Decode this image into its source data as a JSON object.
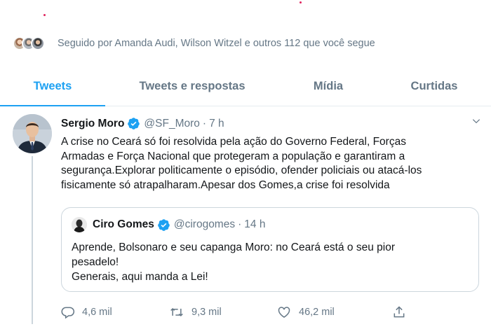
{
  "followed_by": {
    "text": "Seguido por Amanda Audi, Wilson Witzel e outros 112 que você segue",
    "avatars": [
      "avatar-amanda-audi",
      "avatar-wilson-witzel",
      "avatar-follower"
    ]
  },
  "tabs": [
    {
      "label": "Tweets",
      "active": true
    },
    {
      "label": "Tweets e respostas",
      "active": false
    },
    {
      "label": "Mídia",
      "active": false
    },
    {
      "label": "Curtidas",
      "active": false
    }
  ],
  "tweet": {
    "name": "Sergio Moro",
    "handle": "@SF_Moro",
    "separator": "·",
    "time": "7 h",
    "text": "A crise no Ceará só foi resolvida pela ação do Governo Federal, Forças\nArmadas e Força Nacional que protegeram a população e garantiram a\nsegurança.Explorar politicamente o episódio, ofender policiais ou atacá-los\nfisicamente só atrapalharam.Apesar dos Gomes,a crise foi resolvida",
    "quoted": {
      "name": "Ciro Gomes",
      "handle": "@cirogomes",
      "separator": "·",
      "time": "14 h",
      "text": "Aprende, Bolsonaro e seu capanga Moro: no Ceará está o seu pior\npesadelo!\nGenerais, aqui manda a Lei!"
    },
    "actions": {
      "replies": "4,6 mil",
      "retweets": "9,3 mil",
      "likes": "46,2 mil"
    }
  },
  "colors": {
    "accent": "#1da1f2",
    "muted": "#657786",
    "text": "#14171a",
    "border": "#e6ecf0"
  },
  "icons": [
    "verified-badge-icon",
    "caret-down-icon",
    "reply-icon",
    "retweet-icon",
    "like-icon",
    "share-icon"
  ]
}
